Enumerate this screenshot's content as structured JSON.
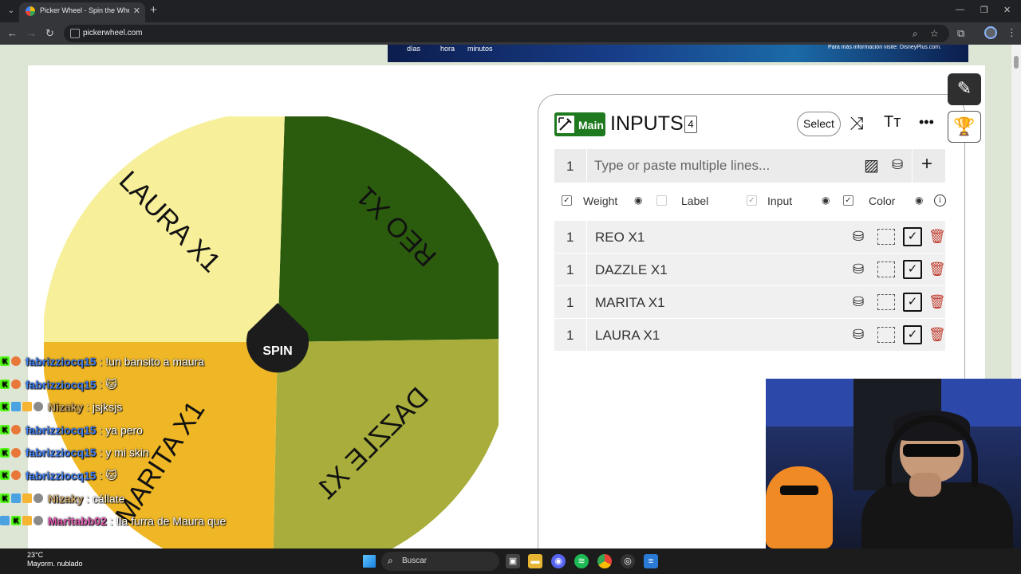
{
  "browser": {
    "tab_title": "Picker Wheel - Spin the Wheel",
    "url": "pickerwheel.com"
  },
  "ad": {
    "items": [
      "días",
      "hora",
      "minutos"
    ],
    "footnote": "Para más información visite: DisneyPlus.com."
  },
  "wheel": {
    "spin_label": "SPIN",
    "segments": [
      {
        "label": "REO X1",
        "color": "#2b5c0e"
      },
      {
        "label": "DAZZLE X1",
        "color": "#a8ad3b"
      },
      {
        "label": "MARITA X1",
        "color": "#efb726"
      },
      {
        "label": "LAURA X1",
        "color": "#f8ef9a"
      }
    ]
  },
  "inputs_panel": {
    "badge": "Main",
    "title": "INPUTS",
    "count": "4",
    "select_label": "Select",
    "entry_number": "1",
    "entry_placeholder": "Type or paste multiple lines...",
    "options": {
      "weight": "Weight",
      "label": "Label",
      "input": "Input",
      "color": "Color"
    },
    "rows": [
      {
        "weight": "1",
        "text": "REO X1"
      },
      {
        "weight": "1",
        "text": "DAZZLE X1"
      },
      {
        "weight": "1",
        "text": "MARITA X1"
      },
      {
        "weight": "1",
        "text": "LAURA X1"
      }
    ]
  },
  "chat": {
    "messages": [
      {
        "user": "fabrizziocq15",
        "text": ": !un bansito a maura",
        "color": "#3d7cf0"
      },
      {
        "user": "fabrizziocq15",
        "text": ": 🐱",
        "color": "#3d7cf0"
      },
      {
        "user": "Nizaky",
        "text": ": jsjksjs",
        "color": "#c8a46a"
      },
      {
        "user": "fabrizziocq15",
        "text": ": ya pero",
        "color": "#3d7cf0"
      },
      {
        "user": "fabrizziocq15",
        "text": ": y mi skin",
        "color": "#3d7cf0"
      },
      {
        "user": "fabrizziocq15",
        "text": ": 🐱",
        "color": "#3d7cf0"
      },
      {
        "user": "Nizaky",
        "text": ": cállate",
        "color": "#c8a46a"
      },
      {
        "user": "Maritabb02",
        "text": ": !la furra de Maura que",
        "color": "#e05ab0"
      }
    ]
  },
  "taskbar": {
    "temp": "23°C",
    "weather": "Mayorm. nublado",
    "search_label": "Buscar"
  }
}
